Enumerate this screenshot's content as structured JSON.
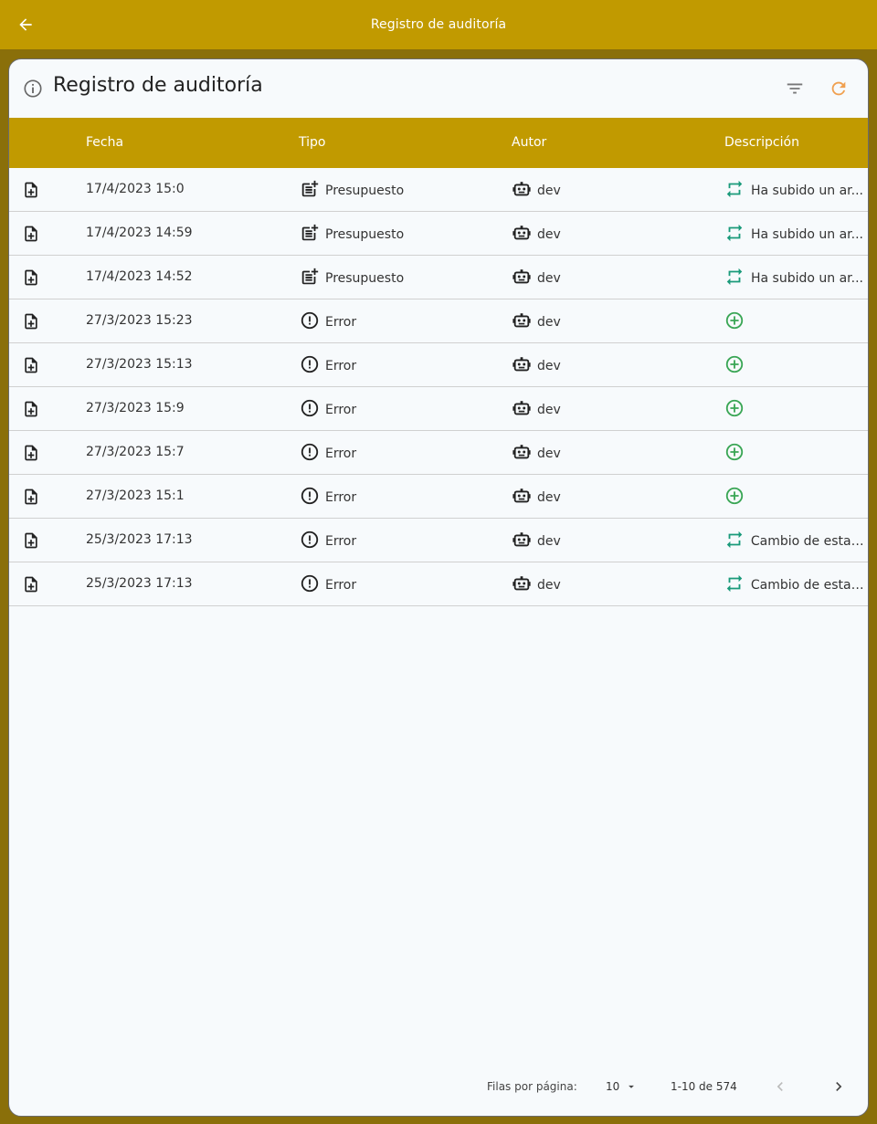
{
  "appbar": {
    "title": "Registro de auditoría"
  },
  "card": {
    "title": "Registro de auditoría",
    "columns": [
      "Fecha",
      "Tipo",
      "Autor",
      "Descripción"
    ],
    "rows": [
      {
        "date": "17/4/2023 15:0",
        "type": "Presupuesto",
        "type_icon": "post-add-icon",
        "author": "dev",
        "desc_icon": "repeat-icon",
        "desc": "Ha subido un ar..."
      },
      {
        "date": "17/4/2023 14:59",
        "type": "Presupuesto",
        "type_icon": "post-add-icon",
        "author": "dev",
        "desc_icon": "repeat-icon",
        "desc": "Ha subido un ar..."
      },
      {
        "date": "17/4/2023 14:52",
        "type": "Presupuesto",
        "type_icon": "post-add-icon",
        "author": "dev",
        "desc_icon": "repeat-icon",
        "desc": "Ha subido un ar..."
      },
      {
        "date": "27/3/2023 15:23",
        "type": "Error",
        "type_icon": "error-icon",
        "author": "dev",
        "desc_icon": "add-circle-icon",
        "desc": ""
      },
      {
        "date": "27/3/2023 15:13",
        "type": "Error",
        "type_icon": "error-icon",
        "author": "dev",
        "desc_icon": "add-circle-icon",
        "desc": ""
      },
      {
        "date": "27/3/2023 15:9",
        "type": "Error",
        "type_icon": "error-icon",
        "author": "dev",
        "desc_icon": "add-circle-icon",
        "desc": ""
      },
      {
        "date": "27/3/2023 15:7",
        "type": "Error",
        "type_icon": "error-icon",
        "author": "dev",
        "desc_icon": "add-circle-icon",
        "desc": ""
      },
      {
        "date": "27/3/2023 15:1",
        "type": "Error",
        "type_icon": "error-icon",
        "author": "dev",
        "desc_icon": "add-circle-icon",
        "desc": ""
      },
      {
        "date": "25/3/2023 17:13",
        "type": "Error",
        "type_icon": "error-icon",
        "author": "dev",
        "desc_icon": "repeat-icon",
        "desc": "Cambio de estad..."
      },
      {
        "date": "25/3/2023 17:13",
        "type": "Error",
        "type_icon": "error-icon",
        "author": "dev",
        "desc_icon": "repeat-icon",
        "desc": "Cambio de estad..."
      }
    ]
  },
  "pagination": {
    "rows_per_page_label": "Filas por página:",
    "rows_per_page": "10",
    "range": "1-10 de 574"
  },
  "colors": {
    "accent": "#c19a00",
    "refresh": "#f0a050",
    "green": "#3aa655",
    "teal": "#1a9a7a"
  }
}
